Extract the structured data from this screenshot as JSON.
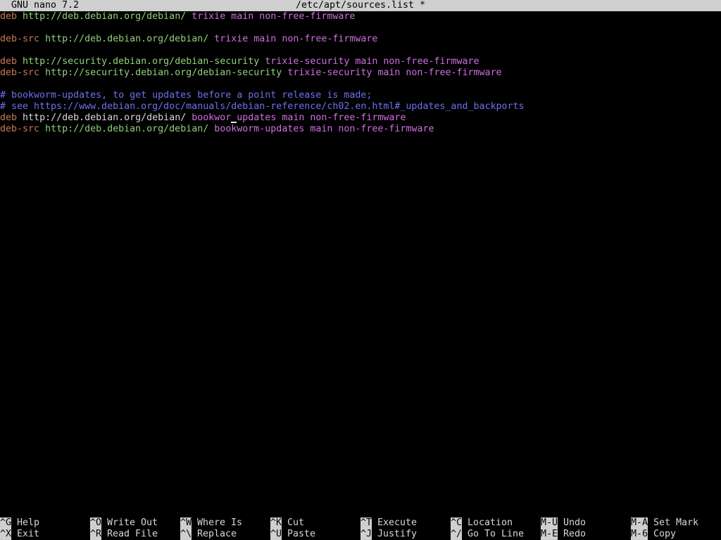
{
  "titlebar": {
    "app": "GNU nano 7.2",
    "file": "/etc/apt/sources.list *"
  },
  "colors": {
    "keyword": "#c8785a",
    "url": "#8fd27a",
    "component": "#cf6fe0",
    "comment": "#6f6ff0",
    "plain": "#d8d8d8"
  },
  "lines": [
    {
      "row": 0,
      "kind": "entry",
      "type": "deb",
      "url": "http://deb.debian.org/debian/",
      "rest": "trixie main non-free-firmware"
    },
    {
      "row": 2,
      "kind": "entry",
      "type": "deb-src",
      "url": "http://deb.debian.org/debian/",
      "rest": "trixie main non-free-firmware"
    },
    {
      "row": 4,
      "kind": "entry",
      "type": "deb",
      "url": "http://security.debian.org/debian-security",
      "rest": "trixie-security main non-free-firmware"
    },
    {
      "row": 5,
      "kind": "entry",
      "type": "deb-src",
      "url": "http://security.debian.org/debian-security",
      "rest": "trixie-security main non-free-firmware"
    },
    {
      "row": 7,
      "kind": "comment",
      "text": "# bookworm-updates, to get updates before a point release is made;"
    },
    {
      "row": 8,
      "kind": "comment",
      "text": "# see https://www.debian.org/doc/manuals/debian-reference/ch02.en.html#_updates_and_backports"
    },
    {
      "row": 9,
      "kind": "cursorline",
      "type": "deb",
      "url": "http://deb.debian.org/debian/",
      "before": "bookwor",
      "after": "updates main non-free-firmware"
    },
    {
      "row": 10,
      "kind": "entry",
      "type": "deb-src",
      "url": "http://deb.debian.org/debian/",
      "rest": "bookworm-updates main non-free-firmware"
    }
  ],
  "shortcuts": [
    {
      "key": "^G",
      "label": "Help",
      "col": 0,
      "row": 0
    },
    {
      "key": "^X",
      "label": "Exit",
      "col": 0,
      "row": 1
    },
    {
      "key": "^O",
      "label": "Write Out",
      "col": 1,
      "row": 0
    },
    {
      "key": "^R",
      "label": "Read File",
      "col": 1,
      "row": 1
    },
    {
      "key": "^W",
      "label": "Where Is",
      "col": 2,
      "row": 0
    },
    {
      "key": "^\\",
      "label": "Replace",
      "col": 2,
      "row": 1
    },
    {
      "key": "^K",
      "label": "Cut",
      "col": 3,
      "row": 0
    },
    {
      "key": "^U",
      "label": "Paste",
      "col": 3,
      "row": 1
    },
    {
      "key": "^T",
      "label": "Execute",
      "col": 4,
      "row": 0
    },
    {
      "key": "^J",
      "label": "Justify",
      "col": 4,
      "row": 1
    },
    {
      "key": "^C",
      "label": "Location",
      "col": 5,
      "row": 0
    },
    {
      "key": "^/",
      "label": "Go To Line",
      "col": 5,
      "row": 1
    },
    {
      "key": "M-U",
      "label": "Undo",
      "col": 6,
      "row": 0
    },
    {
      "key": "M-E",
      "label": "Redo",
      "col": 6,
      "row": 1
    },
    {
      "key": "M-A",
      "label": "Set Mark",
      "col": 7,
      "row": 0
    },
    {
      "key": "M-6",
      "label": "Copy",
      "col": 7,
      "row": 1
    }
  ]
}
